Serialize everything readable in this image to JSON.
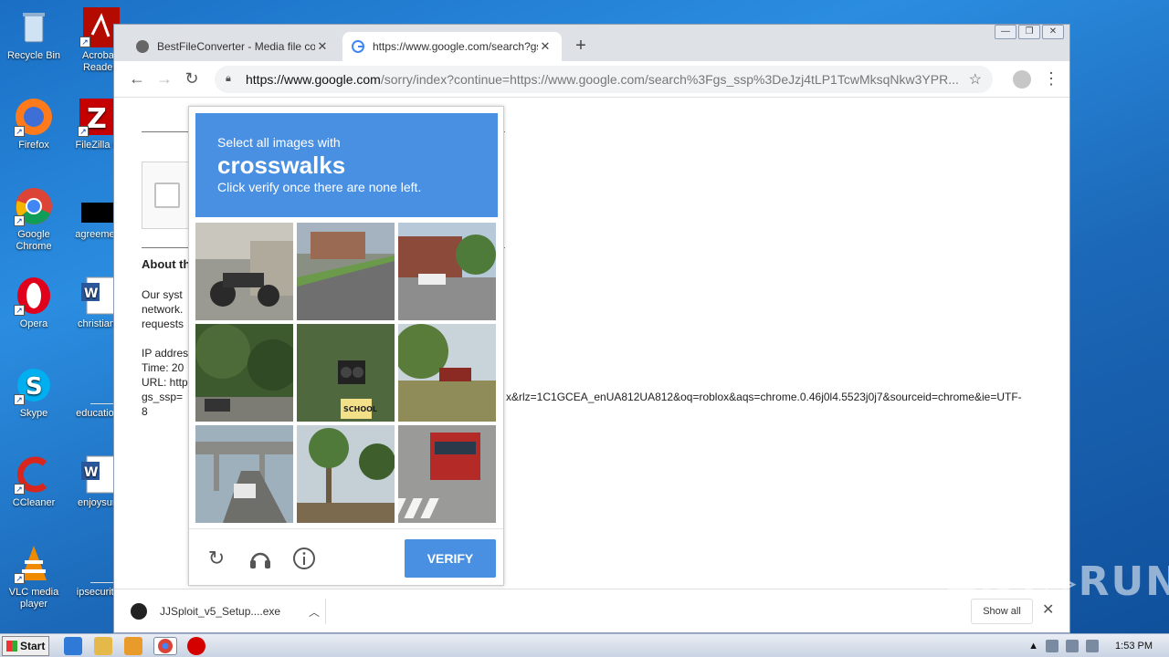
{
  "desktop": {
    "icons": [
      {
        "label": "Recycle Bin"
      },
      {
        "label": "Acrobat Reader"
      },
      {
        "label": "Firefox"
      },
      {
        "label": "FileZilla C"
      },
      {
        "label": "Google Chrome"
      },
      {
        "label": "agreemen"
      },
      {
        "label": "Opera"
      },
      {
        "label": "christianf"
      },
      {
        "label": "Skype"
      },
      {
        "label": "education"
      },
      {
        "label": "CCleaner"
      },
      {
        "label": "enjoysun"
      },
      {
        "label": "VLC media player"
      },
      {
        "label": "ipsecurity"
      }
    ]
  },
  "browser": {
    "tabs": [
      {
        "title": "BestFileConverter - Media file conver",
        "close": "✕"
      },
      {
        "title": "https://www.google.com/search?gs_",
        "close": "✕"
      }
    ],
    "new_tab": "+",
    "window_buttons": {
      "minimize": "—",
      "restore": "❐",
      "close": "✕"
    },
    "omnibox": {
      "host": "https://www.google.com",
      "rest": "/sorry/index?continue=https://www.google.com/search%3Fgs_ssp%3DeJzj4tLP1TcwMksqNkw3YPR..."
    }
  },
  "page": {
    "about_heading": "About th",
    "para": [
      "Our syst",
      "network.",
      "requests"
    ],
    "ip": "IP addres",
    "time": "Time: 20",
    "url_label": "URL: http",
    "url_line": "gs_ssp=",
    "url_tail": "x&rlz=1C1GCEA_enUA812UA812&oq=roblox&aqs=chrome.0.46j0l4.5523j0j7&sourceid=chrome&ie=UTF-",
    "url_tail2": "8"
  },
  "captcha": {
    "instruction_line1": "Select all images with",
    "keyword": "crosswalks",
    "instruction_line3": "Click verify once there are none left.",
    "verify_label": "VERIFY",
    "tiles": [
      "motorcycle-street-tile",
      "suburban-road-tile",
      "house-parking-tile",
      "trees-driveway-tile",
      "school-sign-tile",
      "yard-truck-tile",
      "highway-overpass-tile",
      "palm-tree-tile",
      "crosswalk-bus-tile"
    ]
  },
  "downloads": {
    "file_name": "JJSploit_v5_Setup....exe",
    "show_all": "Show all",
    "close": "✕"
  },
  "watermark": "ANY▷RUN",
  "taskbar": {
    "start_label": "Start",
    "clock": "1:53 PM"
  }
}
